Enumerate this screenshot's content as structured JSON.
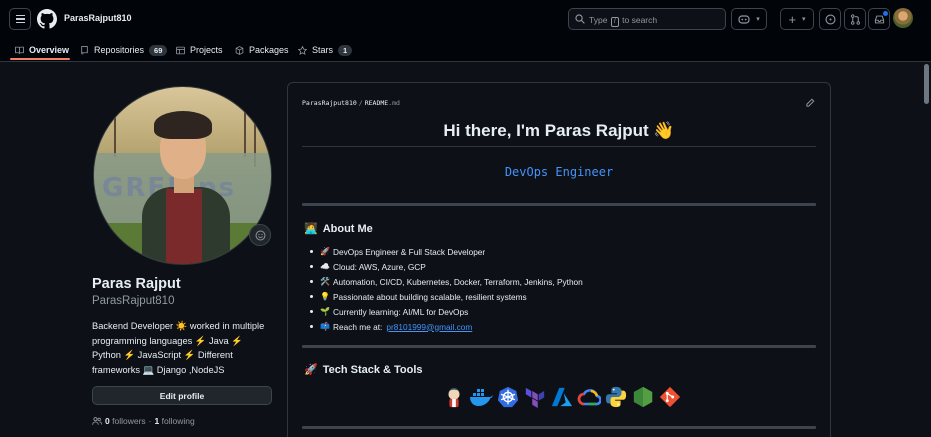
{
  "header": {
    "username": "ParasRajput810",
    "search_text_prefix": "Type",
    "search_key": "/",
    "search_text_suffix": "to search",
    "plus_label": "+"
  },
  "tabs": [
    {
      "label": "Overview",
      "icon": "book-icon",
      "active": true
    },
    {
      "label": "Repositories",
      "icon": "repo-icon",
      "count": "69"
    },
    {
      "label": "Projects",
      "icon": "table-icon"
    },
    {
      "label": "Packages",
      "icon": "package-icon"
    },
    {
      "label": "Stars",
      "icon": "star-icon",
      "count": "1"
    }
  ],
  "profile": {
    "name": "Paras Rajput",
    "login": "ParasRajput810",
    "bio_line1": "Backend Developer ☀️ worked in multiple",
    "bio_line2": "programming languages ⚡ Java ⚡",
    "bio_line3": "Python ⚡ JavaScript ⚡ Different",
    "bio_line4": "frameworks 💻 Django ,NodeJS",
    "edit_label": "Edit profile",
    "followers_count": "0",
    "followers_label": "followers",
    "separator": "·",
    "following_count": "1",
    "following_label": "following"
  },
  "readme": {
    "crumb_owner": "ParasRajput810",
    "crumb_sep": "/",
    "crumb_file": "README",
    "crumb_ext": ".md",
    "title": "Hi there, I'm Paras Rajput 👋",
    "role": "DevOps Engineer",
    "about_heading": "About Me",
    "about_emoji": "🧑‍💻",
    "about_items": [
      {
        "emoji": "🚀",
        "text": "DevOps Engineer & Full Stack Developer"
      },
      {
        "emoji": "☁️",
        "text": "Cloud: AWS, Azure, GCP"
      },
      {
        "emoji": "🛠️",
        "text": "Automation, CI/CD, Kubernetes, Docker, Terraform, Jenkins, Python"
      },
      {
        "emoji": "💡",
        "text": "Passionate about building scalable, resilient systems"
      },
      {
        "emoji": "🌱",
        "text": "Currently learning: AI/ML for DevOps"
      },
      {
        "emoji": "📫",
        "text": "Reach me at:",
        "link": "pr8101999@gmail.com"
      }
    ],
    "tech_heading": "Tech Stack & Tools",
    "tech_emoji": "🚀",
    "tech_icons": [
      "jenkins-icon",
      "docker-icon",
      "kubernetes-icon",
      "terraform-icon",
      "azure-icon",
      "gcp-icon",
      "python-icon",
      "nodejs-icon",
      "git-icon"
    ]
  },
  "colors": {
    "header_bg": "#010409",
    "page_bg": "#0d1117",
    "accent_underline": "#f78166",
    "link": "#4493f8",
    "border": "#30363d"
  }
}
